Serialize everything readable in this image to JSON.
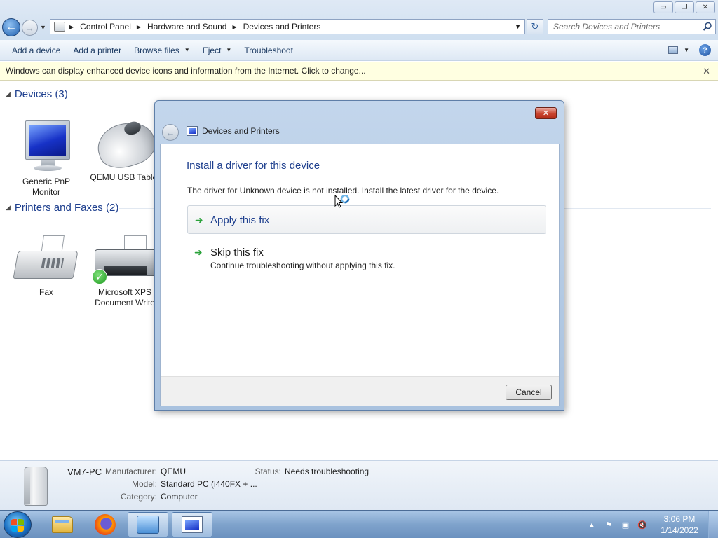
{
  "window": {
    "controls": {
      "minimize": "▭",
      "maximize": "❐",
      "close": "✕"
    }
  },
  "address": {
    "breadcrumbs": [
      "Control Panel",
      "Hardware and Sound",
      "Devices and Printers"
    ],
    "search_placeholder": "Search Devices and Printers"
  },
  "toolbar": {
    "items": [
      {
        "label": "Add a device",
        "dropdown": false
      },
      {
        "label": "Add a printer",
        "dropdown": false
      },
      {
        "label": "Browse files",
        "dropdown": true
      },
      {
        "label": "Eject",
        "dropdown": true
      },
      {
        "label": "Troubleshoot",
        "dropdown": false
      }
    ],
    "help": "?"
  },
  "infobar": {
    "text": "Windows can display enhanced device icons and information from the Internet. Click to change...",
    "close": "✕"
  },
  "groups": {
    "devices": {
      "title": "Devices (3)",
      "items": [
        {
          "name": "Generic PnP Monitor",
          "icon": "monitor-icon"
        },
        {
          "name": "QEMU USB Tablet",
          "icon": "mouse-icon"
        }
      ]
    },
    "printers": {
      "title": "Printers and Faxes (2)",
      "items": [
        {
          "name": "Fax",
          "icon": "fax-icon"
        },
        {
          "name": "Microsoft XPS Document Write",
          "icon": "printer-icon"
        }
      ]
    }
  },
  "details": {
    "name": "VM7-PC",
    "manufacturer_label": "Manufacturer:",
    "manufacturer": "QEMU",
    "model_label": "Model:",
    "model": "Standard PC (i440FX + ...",
    "category_label": "Category:",
    "category": "Computer",
    "status_label": "Status:",
    "status": "Needs troubleshooting"
  },
  "dialog": {
    "title": "Devices and Printers",
    "heading": "Install a driver for this device",
    "description": "The driver for Unknown device is not installed. Install the latest driver for the device.",
    "apply_title": "Apply this fix",
    "skip_title": "Skip this fix",
    "skip_subtitle": "Continue troubleshooting without applying this fix.",
    "cancel": "Cancel",
    "close": "✕"
  },
  "taskbar": {
    "clock_time": "3:06 PM",
    "clock_date": "1/14/2022",
    "accent": "#6b91bf"
  }
}
